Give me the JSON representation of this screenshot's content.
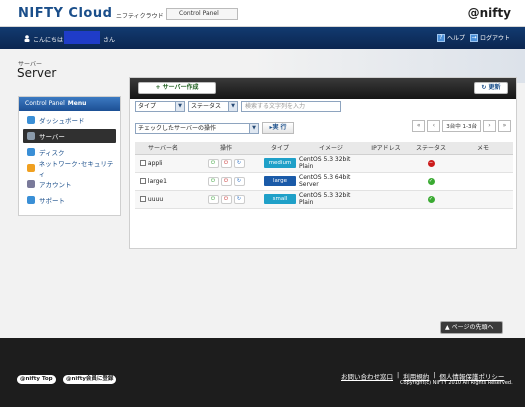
{
  "header": {
    "brand": "NIFTY Cloud",
    "brand_sub": "ニフティクラウド",
    "control_panel": "Control Panel",
    "nifty_logo": "@nifty"
  },
  "userbar": {
    "greeting": "こんにちは",
    "suffix": "さん",
    "help": "ヘルプ",
    "logout": "ログアウト"
  },
  "breadcrumb": "サーバー",
  "page_title": "Server",
  "sidebar": {
    "title_light": "Control Panel",
    "title_bold": "Menu",
    "items": [
      {
        "label": "ダッシュボード",
        "icon": "dashboard-icon",
        "color": "#3a8fd6",
        "active": false
      },
      {
        "label": "サーバー",
        "icon": "server-icon",
        "color": "#8a9aaa",
        "active": true
      },
      {
        "label": "ディスク",
        "icon": "disk-icon",
        "color": "#3a8fd6",
        "active": false
      },
      {
        "label": "ネットワーク･セキュリティ",
        "icon": "network-icon",
        "color": "#f0a020",
        "active": false
      },
      {
        "label": "アカウント",
        "icon": "account-icon",
        "color": "#7a7a9a",
        "active": false
      },
      {
        "label": "サポート",
        "icon": "support-icon",
        "color": "#3a8fd6",
        "active": false
      }
    ]
  },
  "toolbar": {
    "create": "サーバー作成",
    "refresh": "更新"
  },
  "filters": {
    "type": "タイプ",
    "status": "ステータス",
    "search_placeholder": "検索する文字列を入力"
  },
  "actions": {
    "select": "チェックしたサーバーの操作",
    "run": "実 行"
  },
  "pager": {
    "info": "3台中 1-3台"
  },
  "table": {
    "headers": [
      "サーバー名",
      "操作",
      "タイプ",
      "イメージ",
      "IPアドレス",
      "ステータス",
      "メモ"
    ],
    "rows": [
      {
        "name": "appli",
        "type": "medium",
        "type_color": "#1fa0c8",
        "image": "CentOS 5.3 32bit Plain",
        "ip": "",
        "status": "stopped",
        "status_color": "#cc1c1c",
        "memo": ""
      },
      {
        "name": "large1",
        "type": "large",
        "type_color": "#1a5aa8",
        "image": "CentOS 5.3 64bit Server",
        "ip": "",
        "status": "running",
        "status_color": "#3aaa32",
        "memo": ""
      },
      {
        "name": "uuuu",
        "type": "small",
        "type_color": "#1fa0c8",
        "image": "CentOS 5.3 32bit Plain",
        "ip": "",
        "status": "running",
        "status_color": "#3aaa32",
        "memo": ""
      }
    ]
  },
  "footer": {
    "to_top": "ページの先頭へ",
    "nifty_top": "@nifty Top",
    "register": "@nifty会員に登録",
    "links": [
      "お問い合わせ窓口",
      "利用規約",
      "個人情報保護ポリシー"
    ],
    "copyright": "Copyright(c) NIFTY 2010 All Rights Reserved."
  }
}
